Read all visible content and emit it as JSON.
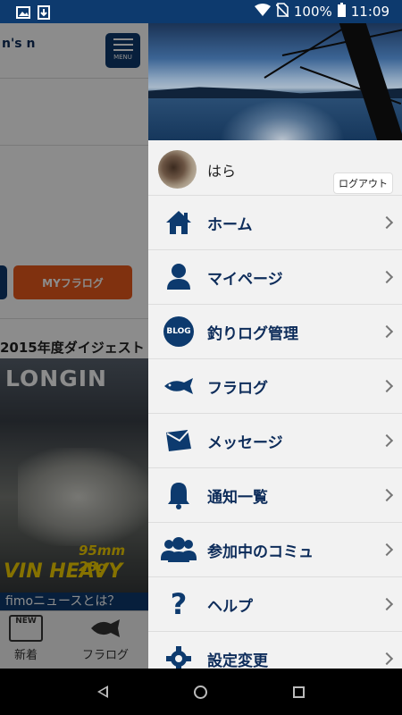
{
  "status_bar": {
    "battery": "100%",
    "time": "11:09",
    "icons": [
      "image-icon",
      "download-icon",
      "wifi-icon",
      "no-sim-icon",
      "battery-icon"
    ]
  },
  "background_app": {
    "logo_partial": "n's n",
    "menu_button_label": "MENU",
    "my_fralog_button": "MYフラログ",
    "section_title": "2015年度ダイジェスト",
    "ad": {
      "brand": "LONGIN",
      "spec": "95mm 28g",
      "product": "VIN HEAVY"
    },
    "news_banner": "fimoニュースとは？",
    "tabs": [
      {
        "label": "新着",
        "icon_text": "NEW"
      },
      {
        "label": "フラログ",
        "icon_text": ""
      }
    ]
  },
  "drawer": {
    "user": {
      "name": "はら",
      "logout_label": "ログアウト"
    },
    "menu": [
      {
        "label": "ホーム",
        "icon": "home-icon"
      },
      {
        "label": "マイページ",
        "icon": "person-icon"
      },
      {
        "label": "釣りログ管理",
        "icon": "blog-icon",
        "icon_text": "BLOG"
      },
      {
        "label": "フラログ",
        "icon": "fish-icon"
      },
      {
        "label": "メッセージ",
        "icon": "envelope-icon"
      },
      {
        "label": "通知一覧",
        "icon": "bell-icon"
      },
      {
        "label": "参加中のコミュ",
        "icon": "group-icon"
      },
      {
        "label": "ヘルプ",
        "icon": "help-icon",
        "icon_text": "?"
      },
      {
        "label": "設定変更",
        "icon": "gear-icon"
      }
    ]
  },
  "colors": {
    "navy": "#0d3a6e",
    "accent_orange": "#e95a1c",
    "menu_text": "#0d2c5a",
    "drawer_bg": "#f2f2f2"
  }
}
